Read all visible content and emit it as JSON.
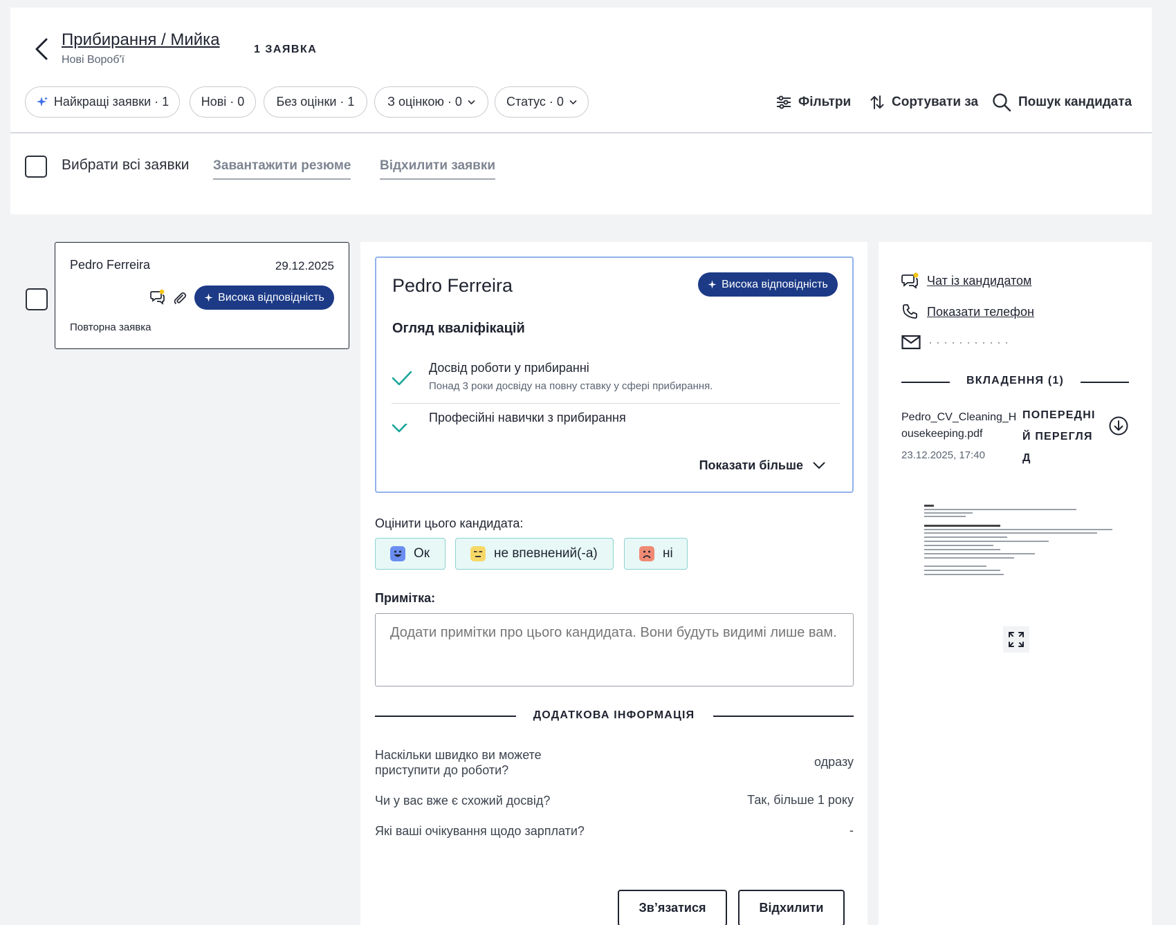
{
  "header": {
    "title": "Прибирання / Мийка",
    "location": "Нові Вороб'ї",
    "applications_count": "1 ЗАЯВКА"
  },
  "filters": {
    "chips": [
      {
        "label": "Найкращі заявки · 1",
        "icon": "sparkle-icon"
      },
      {
        "label": "Нові · 0"
      },
      {
        "label": "Без оцінки · 1"
      },
      {
        "label": "З оцінкою · 0",
        "dropdown": true
      },
      {
        "label": "Статус · 0",
        "dropdown": true
      }
    ],
    "filters_label": "Фільтри",
    "sort_label": "Сортувати за",
    "search_label": "Пошук кандидата"
  },
  "bulk": {
    "select_all_label": "Вибрати всі заявки",
    "download_label": "Завантажити резюме",
    "reject_label": "Відхилити заявки"
  },
  "list": {
    "items": [
      {
        "name": "Pedro Ferreira",
        "date": "29.12.2025",
        "badge": "Висока відповідність",
        "note": "Повторна заявка"
      }
    ]
  },
  "candidate": {
    "name": "Pedro Ferreira",
    "badge": "Висока відповідність",
    "qualifications_title": "Огляд кваліфікацій",
    "qualifications": [
      {
        "title": "Досвід роботи у прибиранні",
        "description": "Понад 3 роки досвіду на повну ставку у сфері прибирання."
      },
      {
        "title": "Професійні навички з прибирання",
        "description": ""
      }
    ],
    "show_more_label": "Показати більше",
    "rate_label": "Оцінити цього кандидата:",
    "ratings": [
      {
        "label": "Ок",
        "color": "#6a8df0"
      },
      {
        "label": "не впевнений(-а)",
        "color": "#f7d867"
      },
      {
        "label": "ні",
        "color": "#f08a74"
      }
    ],
    "note_label": "Примітка:",
    "note_placeholder": "Додати примітки про цього кандидата. Вони будуть видимі лише вам.",
    "additional_title": "ДОДАТКОВА ІНФОРМАЦІЯ",
    "qa": [
      {
        "question": "Наскільки швидко ви можете приступити до роботи?",
        "answer": "одразу"
      },
      {
        "question": "Чи у вас вже є схожий досвід?",
        "answer": "Так, більше 1 року"
      },
      {
        "question": "Які ваші очікування щодо зарплати?",
        "answer": "-"
      }
    ],
    "contact_label": "Зв’язатися",
    "reject_label": "Відхилити"
  },
  "sidebar": {
    "chat_label": "Чат із кандидатом",
    "phone_label": "Показати телефон",
    "email_masked": "·  ·  ·  ·  ·  ·  ·  ·  ·  ·  ·",
    "attachments_title": "ВКЛАДЕННЯ (1)",
    "file_name": "Pedro_CV_Cleaning_Housekeeping.pdf",
    "file_date": "23.12.2025, 17:40",
    "preview_label": "ПОПЕРЕДНІЙ ПЕРЕГЛЯД"
  },
  "colors": {
    "accent_badge": "#1c3a86",
    "check": "#1aa59a",
    "notification_dot": "#f5c518",
    "box_border": "#92b2ec"
  }
}
